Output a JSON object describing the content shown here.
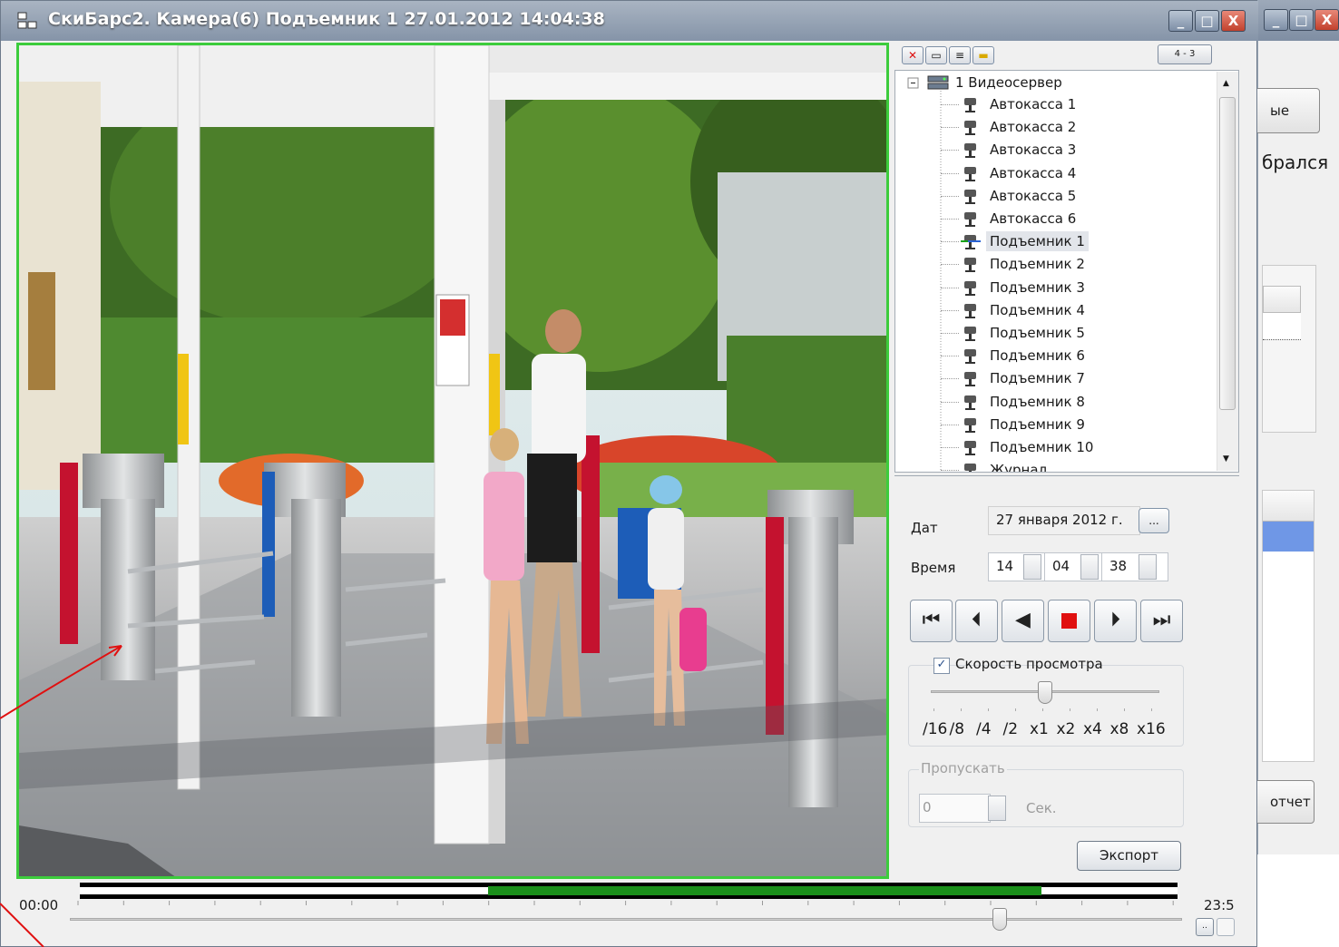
{
  "window": {
    "title": "СкиБарс2. Камера(6) Подъемник 1 27.01.2012 14:04:38",
    "controls": [
      "_",
      "□",
      "X"
    ]
  },
  "background_window": {
    "controls": [
      "_",
      "□",
      "X"
    ],
    "button1": "ые",
    "label": "брался",
    "button2": "отчет"
  },
  "toolbar": {
    "icons": [
      "close-red-icon",
      "monitor-icon",
      "server-icon",
      "folder-icon"
    ],
    "layout_button": "4 - 3"
  },
  "tree": {
    "root": "1 Видеосервер",
    "items": [
      {
        "label": "Автокасса 1"
      },
      {
        "label": "Автокасса 2"
      },
      {
        "label": "Автокасса 3"
      },
      {
        "label": "Автокасса 4"
      },
      {
        "label": "Автокасса 5"
      },
      {
        "label": "Автокасса 6"
      },
      {
        "label": "Подъемник 1",
        "selected": true
      },
      {
        "label": "Подъемник 2"
      },
      {
        "label": "Подъемник 3"
      },
      {
        "label": "Подъемник 4"
      },
      {
        "label": "Подъемник 5"
      },
      {
        "label": "Подъемник 6"
      },
      {
        "label": "Подъемник 7"
      },
      {
        "label": "Подъемник 8"
      },
      {
        "label": "Подъемник 9"
      },
      {
        "label": "Подъемник 10"
      },
      {
        "label": "Журнал"
      }
    ]
  },
  "playback": {
    "date_label": "Дат",
    "date_value": "27 января 2012 г.",
    "date_button": "...",
    "time_label": "Время",
    "hours": "14",
    "minutes": "04",
    "seconds": "38",
    "speed_checkbox_label": "Скорость просмотра",
    "speed_checked": true,
    "speed_levels": [
      "/16",
      "/8",
      "/4",
      "/2",
      "x1",
      "x2",
      "x4",
      "x8",
      "x16"
    ],
    "speed_selected": "x1",
    "skip_group_label": "Пропускать",
    "skip_value": "0",
    "skip_unit": "Сек.",
    "export_button": "Экспорт"
  },
  "timeline": {
    "start": "00:00",
    "end": "23:5",
    "slider_position_fraction": 0.83
  },
  "colors": {
    "video_border": "#3ccc3c",
    "timeline_recorded": "#1a8f1a",
    "stop_red": "#e01010",
    "annotation_arrow": "#e01010"
  }
}
